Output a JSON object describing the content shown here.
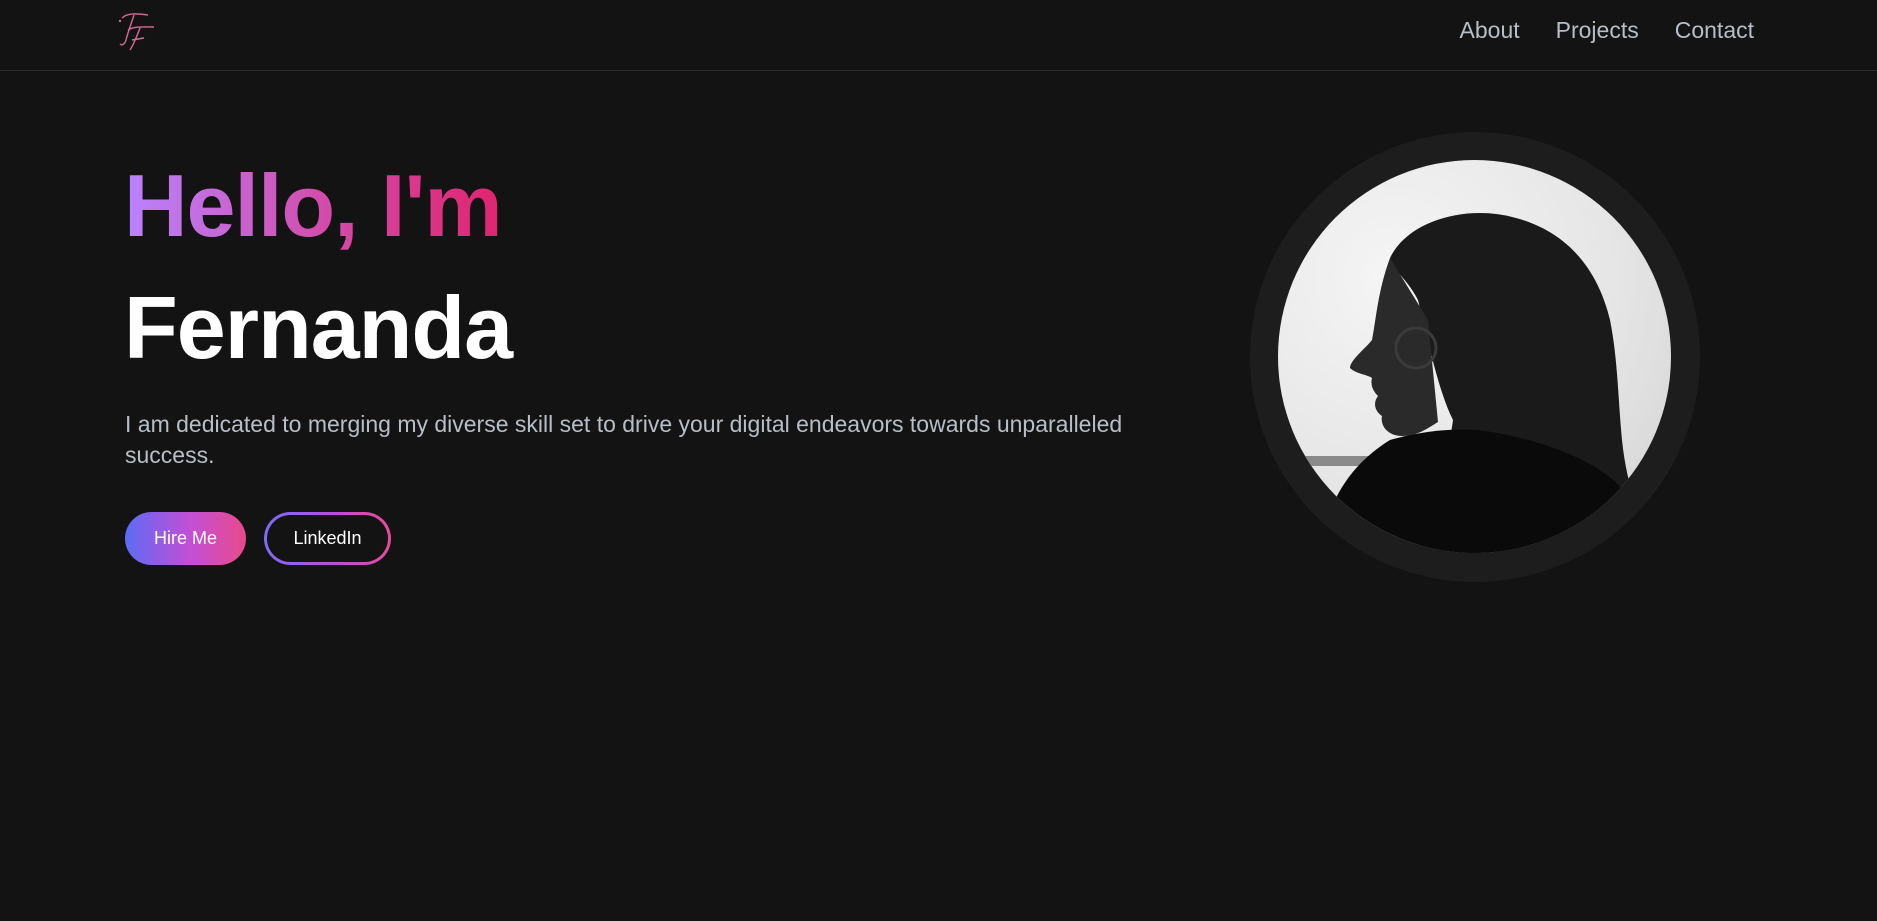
{
  "brand": {
    "logo_text": "TF",
    "logo_color": "#e07aa3"
  },
  "nav": {
    "items": [
      "About",
      "Projects",
      "Contact"
    ]
  },
  "hero": {
    "greeting": "Hello, I'm",
    "name": "Fernanda",
    "tagline": "I am dedicated to merging my diverse skill set to drive your digital endeavors towards unparalleled success.",
    "primary_button": "Hire Me",
    "secondary_button": "LinkedIn"
  },
  "colors": {
    "background": "#131313",
    "accent_purple": "#b983ff",
    "accent_pink": "#e0246f",
    "muted_text": "#b8bec7"
  }
}
